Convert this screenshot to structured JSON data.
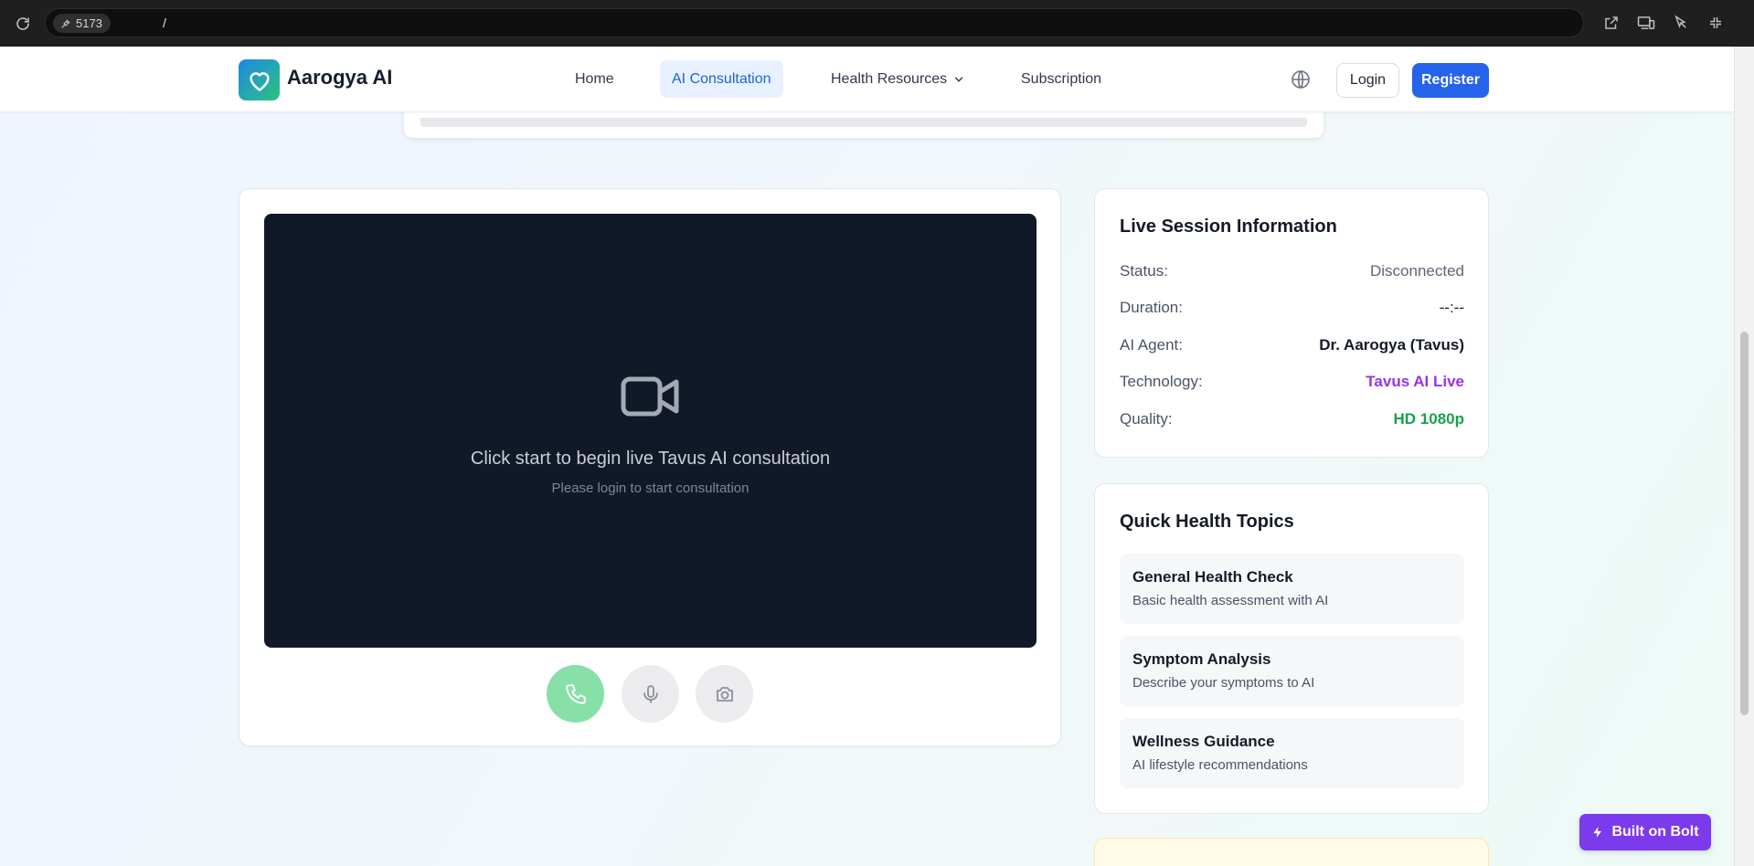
{
  "browser": {
    "port": "5173",
    "path": "/"
  },
  "nav": {
    "brand": "Aarogya AI",
    "links": [
      "Home",
      "AI Consultation",
      "Health Resources",
      "Subscription"
    ],
    "login": "Login",
    "register": "Register"
  },
  "video": {
    "main_text": "Click start to begin live Tavus AI consultation",
    "sub_text": "Please login to start consultation"
  },
  "session": {
    "title": "Live Session Information",
    "rows": [
      {
        "label": "Status:",
        "value": "Disconnected",
        "color": "#5c6675"
      },
      {
        "label": "Duration:",
        "value": "--:--",
        "color": "#141a26"
      },
      {
        "label": "AI Agent:",
        "value": "Dr. Aarogya (Tavus)",
        "color": "#141a26"
      },
      {
        "label": "Technology:",
        "value": "Tavus AI Live",
        "color": "#9333ea"
      },
      {
        "label": "Quality:",
        "value": "HD 1080p",
        "color": "#16a34a"
      }
    ]
  },
  "topics": {
    "title": "Quick Health Topics",
    "items": [
      {
        "title": "General Health Check",
        "desc": "Basic health assessment with AI"
      },
      {
        "title": "Symptom Analysis",
        "desc": "Describe your symptoms to AI"
      },
      {
        "title": "Wellness Guidance",
        "desc": "AI lifestyle recommendations"
      }
    ]
  },
  "badge": {
    "label": "Built on Bolt"
  },
  "colors": {
    "primary": "#2563eb",
    "video_bg": "#111827",
    "call_button": "#86e0a8",
    "bolt_purple": "#7c3aed"
  }
}
